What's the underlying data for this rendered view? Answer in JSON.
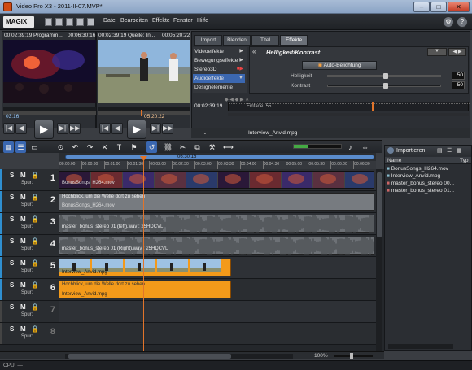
{
  "window": {
    "title": "Video Pro X3 - 2011-II-07.MVP*"
  },
  "menubar": {
    "logo": "MAGIX",
    "items": [
      "Datei",
      "Bearbeiten",
      "Effekte",
      "Fenster",
      "Hilfe"
    ]
  },
  "source_monitor": {
    "timecode_left": "00:02:39:19",
    "title": "Programm...",
    "timecode_right": "00:06:30:16",
    "track_in": "03:16"
  },
  "program_monitor": {
    "timecode_left": "00:02:39:19",
    "title": "Quelle: In...",
    "timecode_right": "00:05:20:22",
    "track_in": "05:20:22"
  },
  "effects": {
    "tabs": [
      "Import",
      "Blenden",
      "Titel",
      "Effekte"
    ],
    "active_tab": "Effekte",
    "list": [
      "Videoeffekte",
      "Bewegungseffekte",
      "Stereo3D",
      "Audioeffekte",
      "Designelemente"
    ],
    "selected": "Audioeffekte",
    "heading": "Helligkeit/Kontrast",
    "auto_button": "Auto-Belichtung",
    "params": [
      {
        "label": "Helligkeit",
        "value": "50"
      },
      {
        "label": "Kontrast",
        "value": "50"
      }
    ],
    "timecode": "00:02:39:19",
    "keyframe_label": "Einfade: 55"
  },
  "monitor_caption": "Interview_Anvid.mpg",
  "timeline": {
    "ruler_top": "06:30:16",
    "ruler_marks": [
      "00:00:00",
      "00:00:30",
      "00:01:00",
      "00:01:30",
      "00:02:00",
      "00:02:30",
      "00:03:00",
      "00:03:30",
      "00:04:00",
      "00:04:30",
      "00:05:00",
      "00:05:30",
      "00:06:00",
      "00:06:30"
    ],
    "zoom_label": "100%",
    "tracks": [
      {
        "num": "1",
        "label": "Spur:",
        "clip": "BonusSongs_H264.mov"
      },
      {
        "num": "2",
        "label": "Spur:",
        "clip": "Hochblick, um die Welle dort zu sehen",
        "subclip": "BonusSongs_H264.mov"
      },
      {
        "num": "3",
        "label": "Spur:",
        "clip": "master_bonus_stereo 01 (left).wav : 25HDCVL"
      },
      {
        "num": "4",
        "label": "Spur:",
        "clip": "master_bonus_stereo 01 (Right).wav : 25HDCVL"
      },
      {
        "num": "5",
        "label": "Spur:",
        "clip": "Interview_Anvid.mpg"
      },
      {
        "num": "6",
        "label": "Spur:",
        "clip": "Hochblick, um die Welle dort zu sehen",
        "subclip": "Interview_Anvid.mpg"
      },
      {
        "num": "7",
        "label": "Spur:",
        "clip": ""
      },
      {
        "num": "8",
        "label": "Spur:",
        "clip": ""
      }
    ]
  },
  "importer": {
    "title": "Importieren",
    "columns": [
      "Name",
      "Typ"
    ],
    "files": [
      "BonusSongs_H264.mov",
      "Interview_Anvid.mpg",
      "master_bonus_stereo 00...",
      "master_bonus_stereo 01..."
    ]
  },
  "status": {
    "cpu": "CPU: —"
  },
  "colors": {
    "accent": "#3b67b0",
    "clip_orange": "#f39a1a",
    "playhead": "#e2742a"
  }
}
